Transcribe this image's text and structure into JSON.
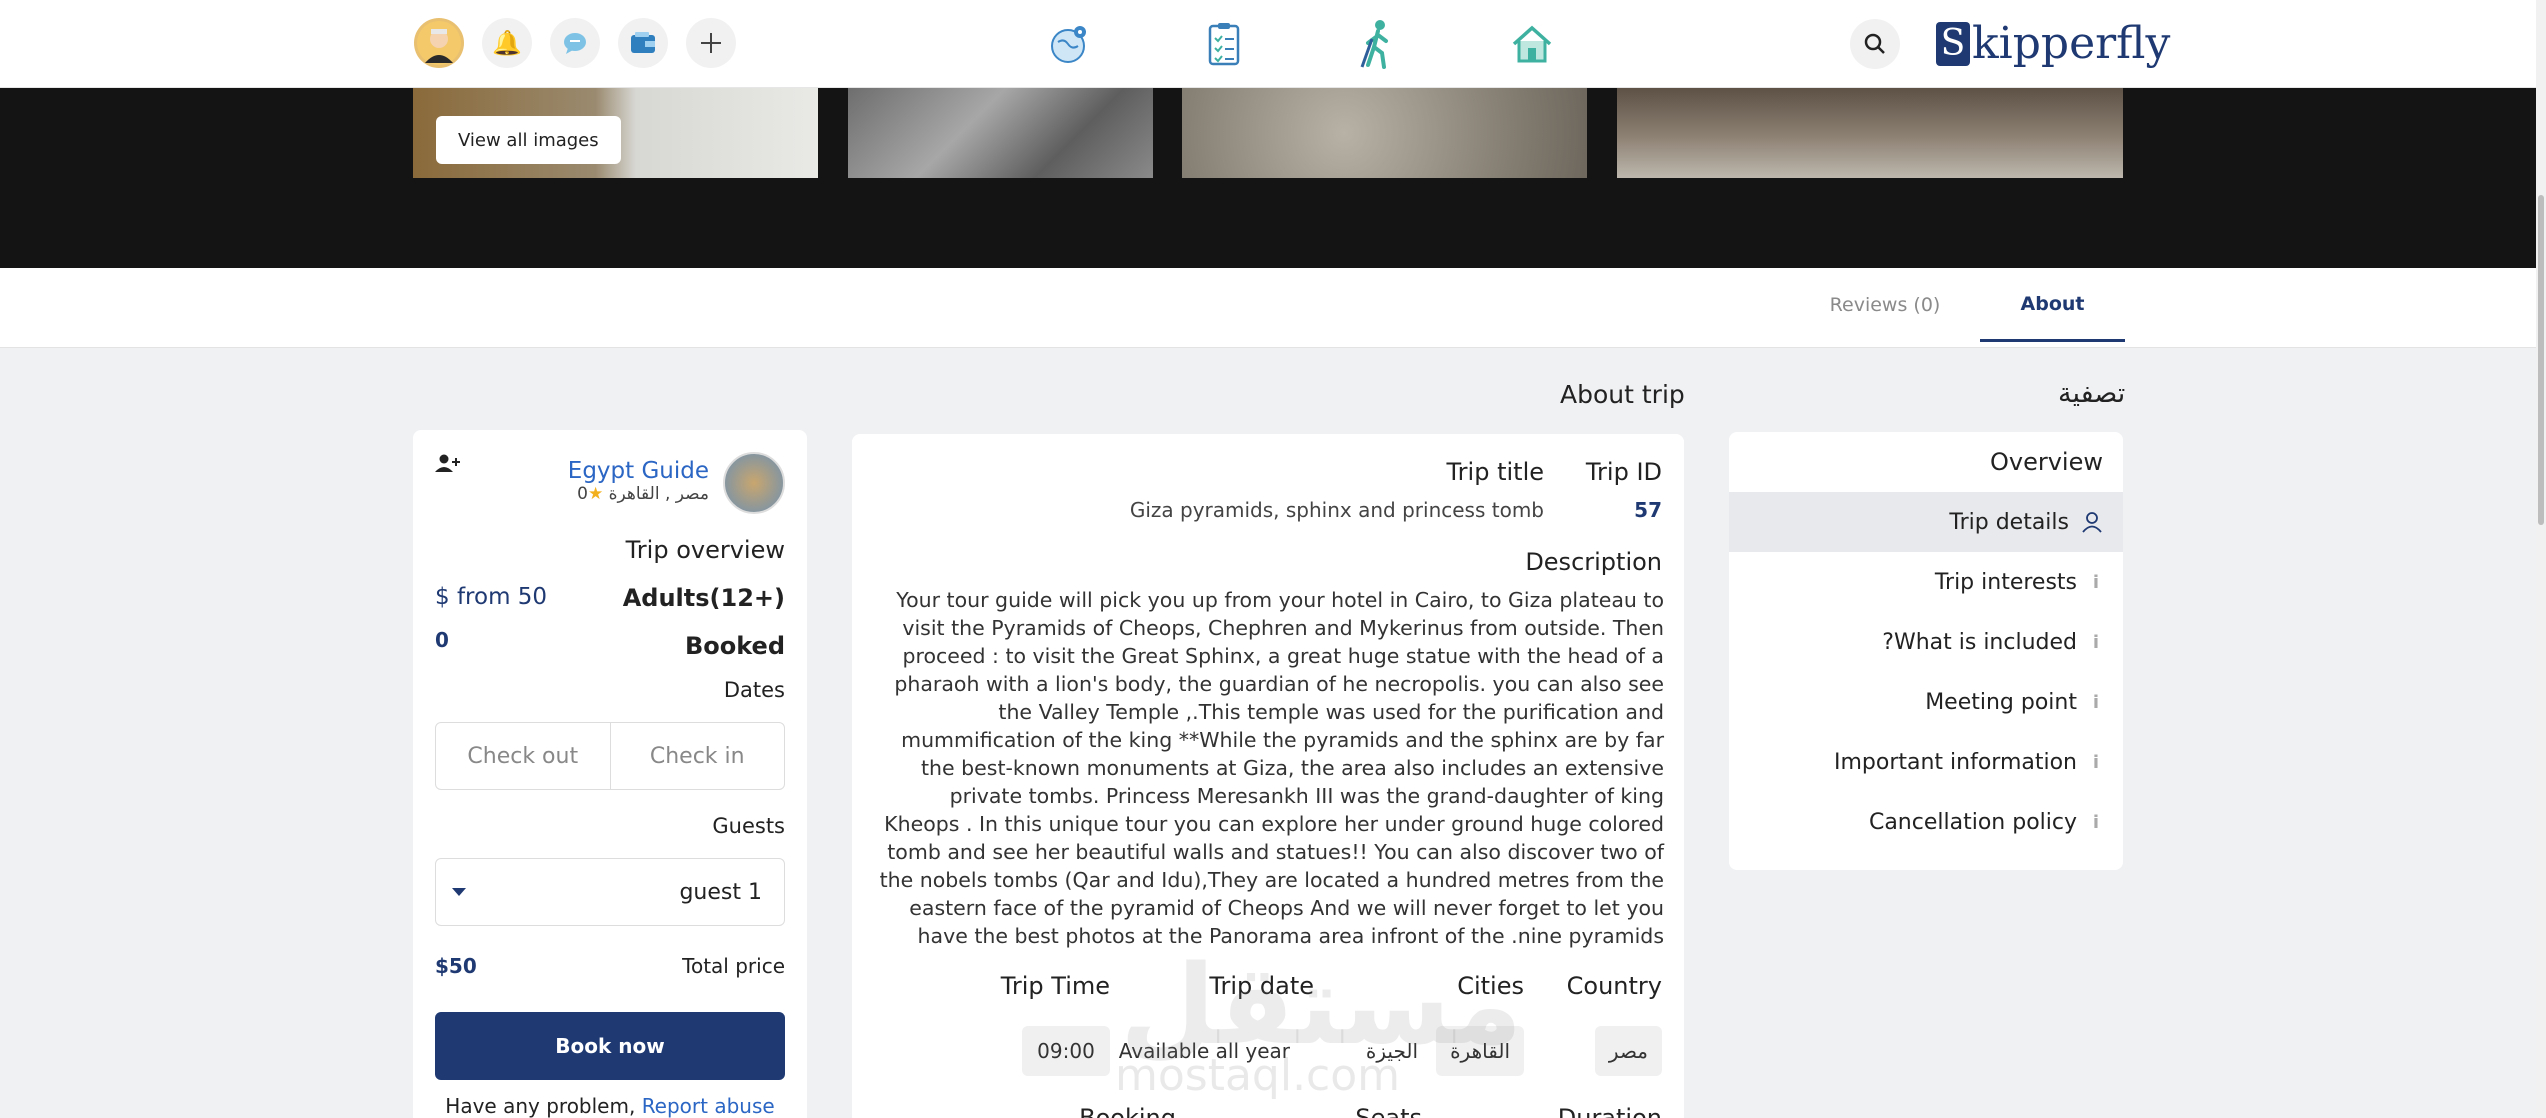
{
  "header": {
    "logo_text": "kipperfly",
    "logo_initial": "S"
  },
  "gallery": {
    "view_all_label": "View all images"
  },
  "tabs": {
    "reviews": "Reviews (0)",
    "about": "About"
  },
  "sidebar": {
    "title": "تصفية",
    "items": [
      {
        "label": "Overview"
      },
      {
        "label": "Trip details"
      },
      {
        "label": "Trip interests"
      },
      {
        "label": "?What is included"
      },
      {
        "label": "Meeting point"
      },
      {
        "label": "Important information"
      },
      {
        "label": "Cancellation policy"
      }
    ]
  },
  "about": {
    "title": "About trip",
    "trip_id_label": "Trip ID",
    "trip_id": "57",
    "trip_title_label": "Trip title",
    "trip_title": "Giza pyramids, sphinx and princess tomb",
    "description_label": "Description",
    "description": "Your tour guide will pick you up from your hotel in Cairo, to Giza plateau to visit the Pyramids of Cheops, Chephren and Mykerinus from outside. Then proceed : to visit the Great Sphinx, a great huge statue with the head of a pharaoh with a lion's body, the guardian of he necropolis. you can also see the Valley Temple ,.This temple was used for the purification and mummification of the king **While the pyramids and the sphinx are by far the best-known monuments at Giza, the area also includes an extensive private tombs. Princess Meresankh III was the grand-daughter of king Kheops . In this unique tour you can explore her under ground huge colored tomb and see her beautiful walls and statues!! You can also discover two of the nobels tombs (Qar and Idu),They are located a hundred metres from the eastern face of the pyramid of Cheops And we will never forget to let you have the best photos at the Panorama area infront of the .nine pyramids",
    "country_label": "Country",
    "country": "مصر",
    "cities_label": "Cities",
    "cities": [
      "القاهرة",
      "الجيزة"
    ],
    "trip_date_label": "Trip date",
    "trip_date": "Available all year",
    "trip_time_label": "Trip Time",
    "trip_time": "09:00",
    "more_labels": [
      "Duration",
      "Seats",
      "Booking"
    ]
  },
  "booking": {
    "guide_name": "Egypt Guide",
    "guide_location": "مصر , القاهرة",
    "guide_rating": "0",
    "overview_label": "Trip overview",
    "adults_label": "Adults(12+)",
    "price_from": "$ from 50",
    "booked_label": "Booked",
    "booked_count": "0",
    "dates_label": "Dates",
    "check_in": "Check in",
    "check_out": "Check out",
    "guests_label": "Guests",
    "guests_value": "guest 1",
    "total_label": "Total price",
    "total_value": "$50",
    "book_now": "Book now",
    "problem_text": "Have any problem,",
    "report_link": "Report abuse"
  },
  "watermark": {
    "arabic": "مستقل",
    "latin": "mostaql.com"
  }
}
